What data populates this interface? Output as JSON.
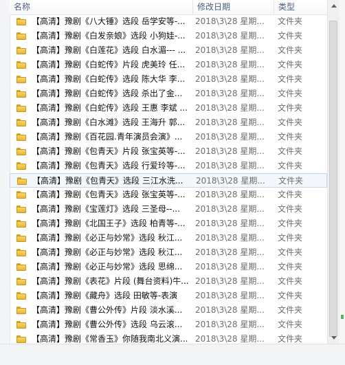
{
  "columns": {
    "name": "名称",
    "date": "修改日期",
    "type": "类型"
  },
  "files": [
    {
      "name": "【高清】豫剧《八大锤》选段 岳学安等-...",
      "date": "2018\\3\\28 星期...",
      "type": "文件夹"
    },
    {
      "name": "【高清】豫剧《白发亲娘》选段 小狗娃-...",
      "date": "2018\\3\\28 星期...",
      "type": "文件夹"
    },
    {
      "name": "【高清】豫剧《白莲花》选段 白水湄--- ...",
      "date": "2018\\3\\28 星期...",
      "type": "文件夹"
    },
    {
      "name": "【高清】豫剧《白蛇传》片段 虎美玲 任...",
      "date": "2018\\3\\28 星期...",
      "type": "文件夹"
    },
    {
      "name": "【高清】豫剧《白蛇传》选段 陈大华 李...",
      "date": "2018\\3\\28 星期...",
      "type": "文件夹"
    },
    {
      "name": "【高清】豫剧《白蛇传》选段 杀出了金...",
      "date": "2018\\3\\28 星期...",
      "type": "文件夹"
    },
    {
      "name": "【高清】豫剧《白蛇传》选段 王惠 李斌 ...",
      "date": "2018\\3\\28 星期...",
      "type": "文件夹"
    },
    {
      "name": "【高清】豫剧《白水滩》选段 王海升 郭...",
      "date": "2018\\3\\28 星期...",
      "type": "文件夹"
    },
    {
      "name": "【高清】豫剧《百花园.青年演员会演》...",
      "date": "2018\\3\\28 星期...",
      "type": "文件夹"
    },
    {
      "name": "【高清】豫剧《包青天》片段 张宝英等-...",
      "date": "2018\\3\\28 星期...",
      "type": "文件夹"
    },
    {
      "name": "【高清】豫剧《包青天》选段 行爱玲等-...",
      "date": "2018\\3\\28 星期...",
      "type": "文件夹"
    },
    {
      "name": "【高清】豫剧《包青天》选段 三江水洗...",
      "date": "2018\\3\\28 星期...",
      "type": "文件夹"
    },
    {
      "name": "【高清】豫剧《包青天》选段 张宝英等-...",
      "date": "2018\\3\\28 星期...",
      "type": "文件夹"
    },
    {
      "name": "【高清】豫剧《宝莲灯》选段 三圣母--...",
      "date": "2018\\3\\28 星期...",
      "type": "文件夹"
    },
    {
      "name": "【高清】豫剧《北国王子》选段 柏青等-...",
      "date": "2018\\3\\28 星期...",
      "type": "文件夹"
    },
    {
      "name": "【高清】豫剧《必正与妙常》选段 秋江...",
      "date": "2018\\3\\28 星期...",
      "type": "文件夹"
    },
    {
      "name": "【高清】豫剧《必正与妙常》选段 秋江...",
      "date": "2018\\3\\28 星期...",
      "type": "文件夹"
    },
    {
      "name": "【高清】豫剧《必正与妙常》选段 思绵...",
      "date": "2018\\3\\28 星期...",
      "type": "文件夹"
    },
    {
      "name": "【高清】豫剧《表花》片段 (舞台资料)牛...",
      "date": "2018\\3\\28 星期...",
      "type": "文件夹"
    },
    {
      "name": "【高清】豫剧《藏舟》选段 田敏等-表演",
      "date": "2018\\3\\28 星期...",
      "type": "文件夹"
    },
    {
      "name": "【高清】豫剧《曹公外传》片段 淡水溪...",
      "date": "2018\\3\\28 星期...",
      "type": "文件夹"
    },
    {
      "name": "【高清】豫剧《曹公外传》选段 乌云滚...",
      "date": "2018\\3\\28 星期...",
      "type": "文件夹"
    },
    {
      "name": "【高清】豫剧《常香玉》你随我南北义演...",
      "date": "2018\\3\\28 星期...",
      "type": "文件夹"
    }
  ],
  "hover_index": 11,
  "icon": "folder-icon",
  "colors": {
    "folder": "#f2c84b",
    "hover_border": "#c5d7ee",
    "header_text": "#4c607a"
  }
}
